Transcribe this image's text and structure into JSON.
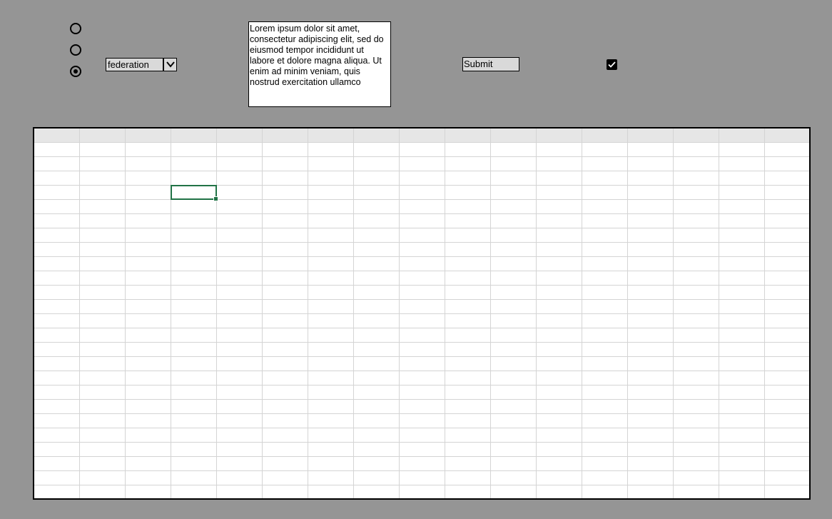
{
  "radios": [
    {
      "checked": false
    },
    {
      "checked": false
    },
    {
      "checked": true
    }
  ],
  "dropdown": {
    "selected": "federation",
    "icon": "chevron-down-icon"
  },
  "textarea": {
    "value": "Lorem ipsum dolor sit amet, consectetur adipiscing elit, sed do\neiusmod tempor incididunt ut labore et dolore magna aliqua. Ut\nenim ad minim veniam, quis nostrud exercitation ullamco"
  },
  "submit": {
    "label": "Submit"
  },
  "checkbox": {
    "checked": true,
    "icon": "checkmark-icon"
  },
  "colors": {
    "background": "#959595",
    "grid_line": "#d4d4d4",
    "header_fill": "#e6e6e6",
    "active_cell": "#217346"
  }
}
